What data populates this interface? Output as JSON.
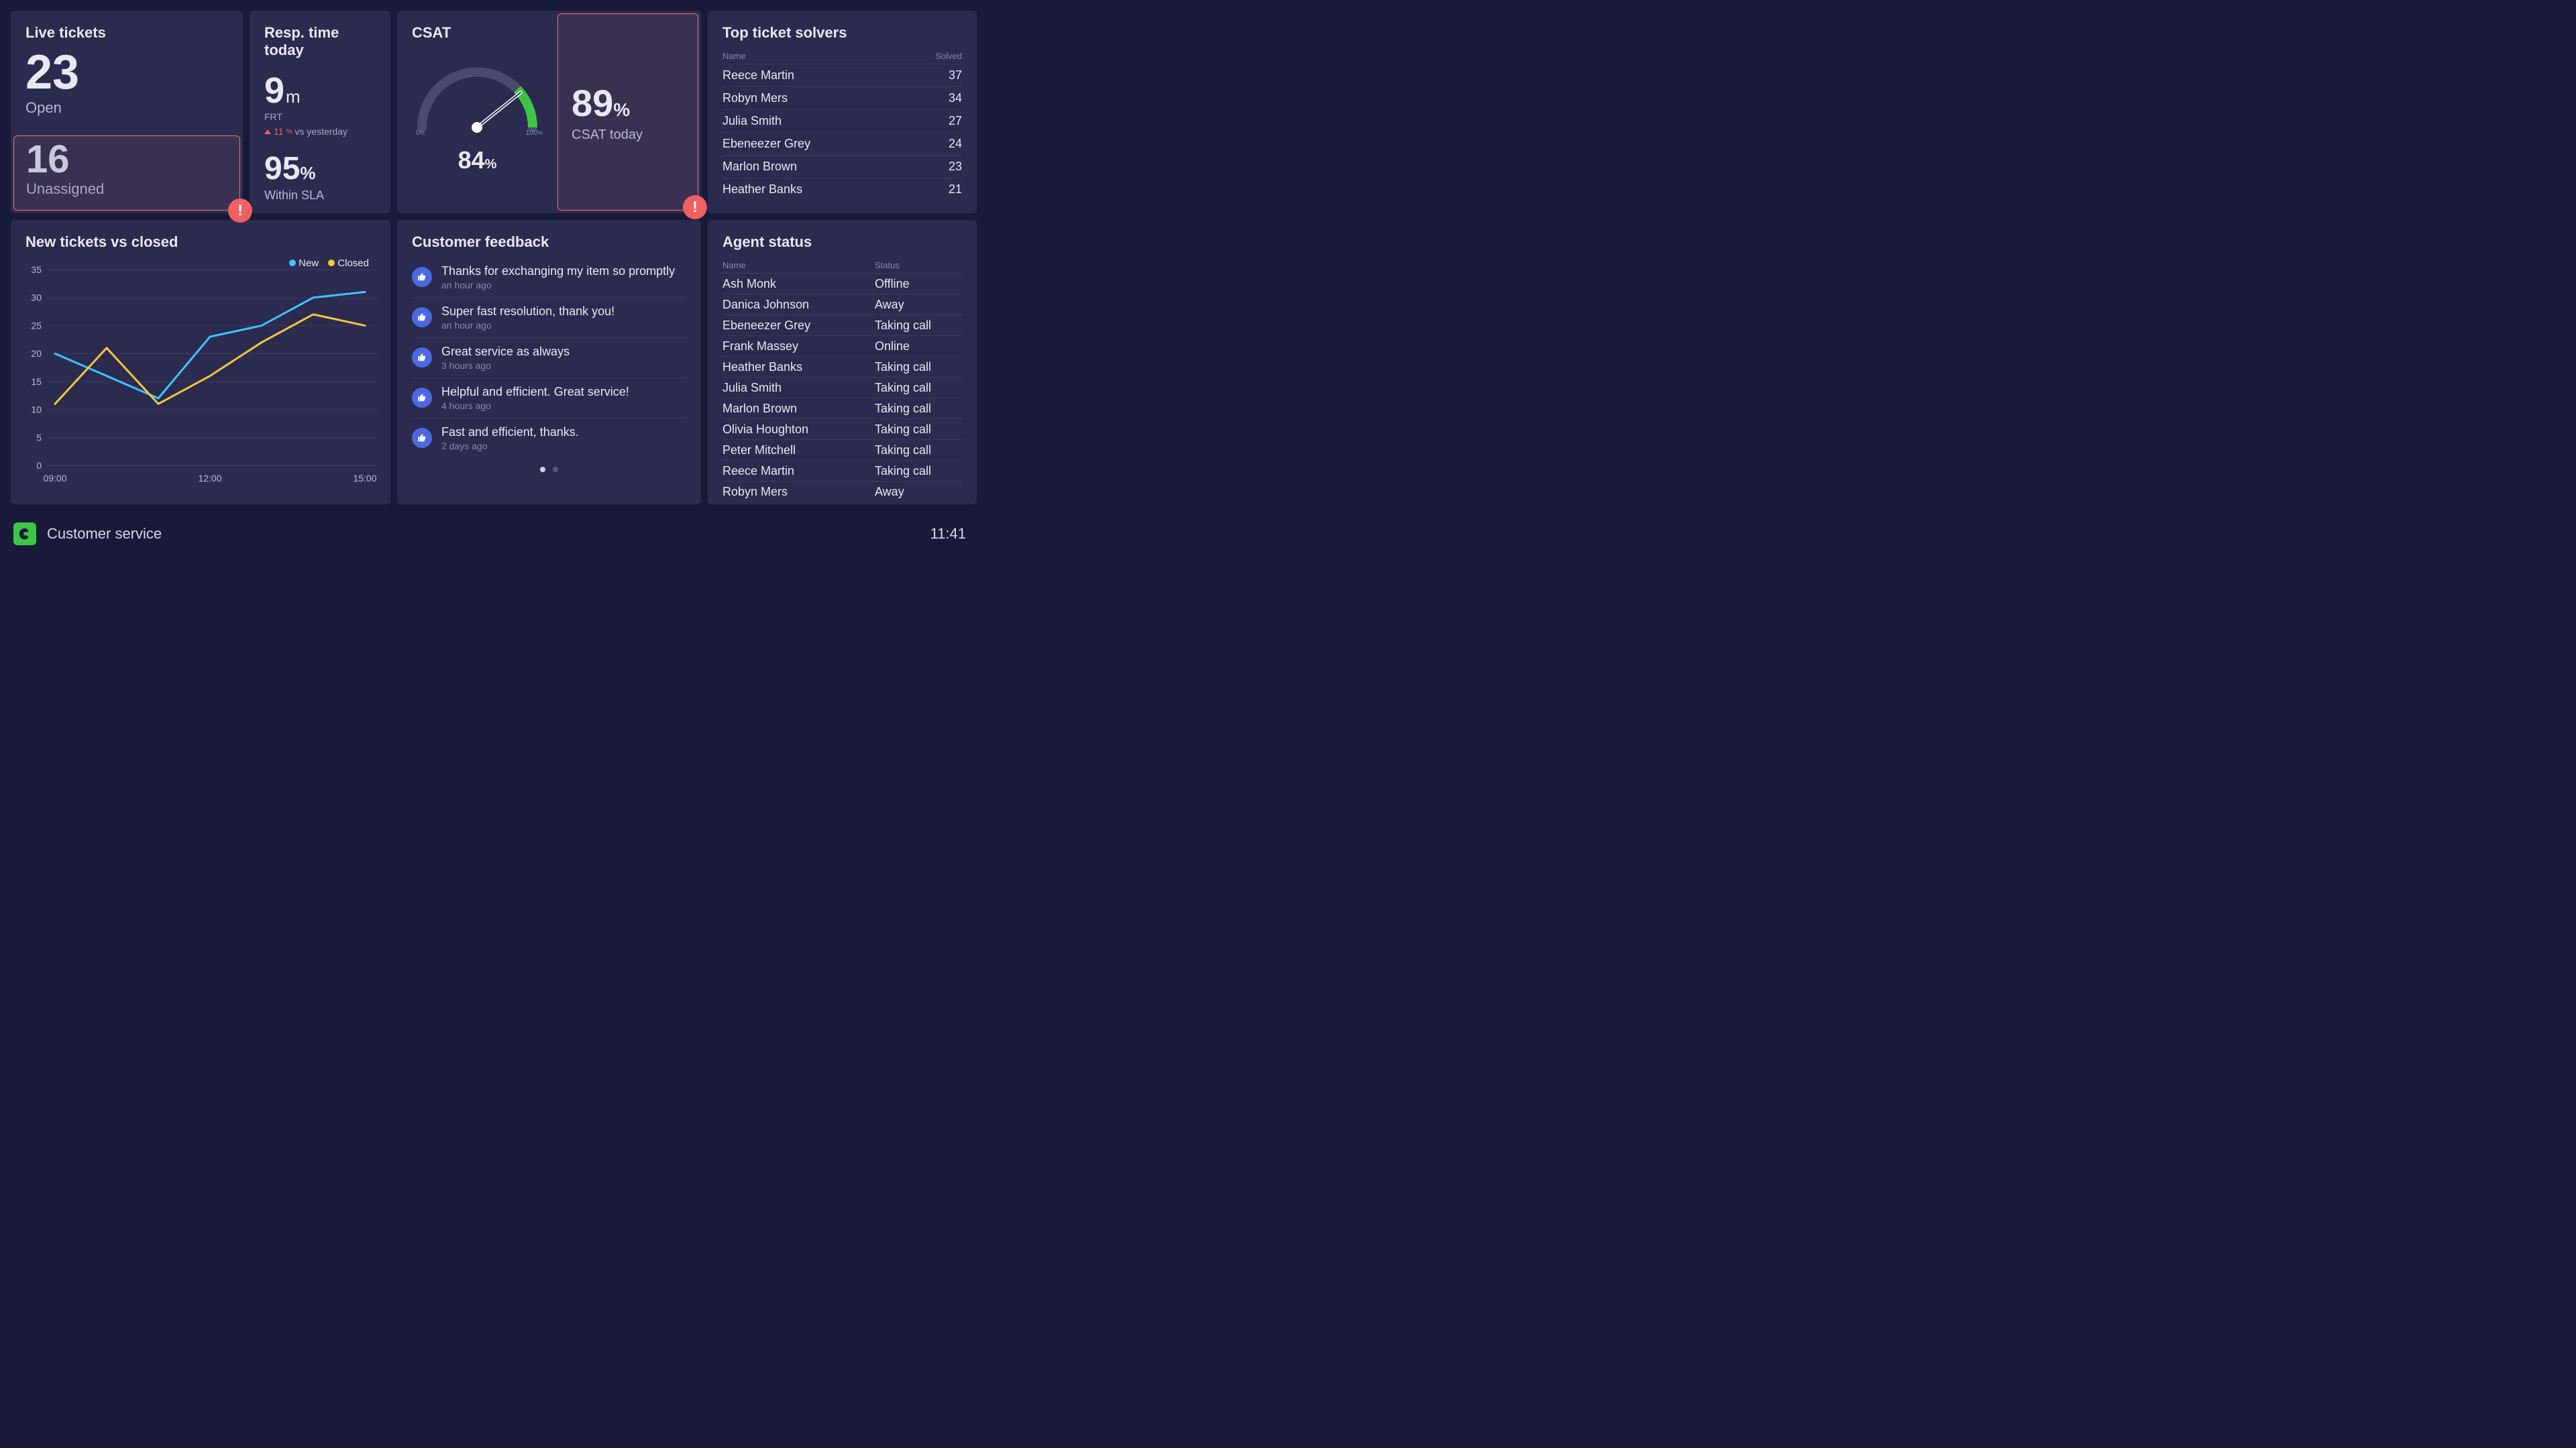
{
  "live_tickets": {
    "title": "Live tickets",
    "open_value": "23",
    "open_label": "Open",
    "unassigned_value": "16",
    "unassigned_label": "Unassigned"
  },
  "resp_time": {
    "title": "Resp. time today",
    "frt_value": "9",
    "frt_unit": "m",
    "frt_label": "FRT",
    "change_value": "11",
    "change_pct": "%",
    "change_vs": "vs yesterday",
    "sla_value": "95",
    "sla_pct": "%",
    "sla_label": "Within SLA"
  },
  "csat": {
    "title": "CSAT",
    "gauge_value": "84",
    "gauge_pct": "%",
    "scale_min": "0",
    "scale_min_pct": "%",
    "scale_max": "100",
    "scale_max_pct": "%",
    "today_value": "89",
    "today_pct": "%",
    "today_label": "CSAT today"
  },
  "top_solvers": {
    "title": "Top ticket solvers",
    "col_name": "Name",
    "col_solved": "Solved",
    "rows": [
      {
        "name": "Reece Martin",
        "solved": "37"
      },
      {
        "name": "Robyn Mers",
        "solved": "34"
      },
      {
        "name": "Julia Smith",
        "solved": "27"
      },
      {
        "name": "Ebeneezer Grey",
        "solved": "24"
      },
      {
        "name": "Marlon Brown",
        "solved": "23"
      },
      {
        "name": "Heather Banks",
        "solved": "21"
      }
    ]
  },
  "tickets_chart": {
    "title": "New tickets vs closed",
    "legend_new": "New",
    "legend_closed": "Closed"
  },
  "chart_data": {
    "type": "line",
    "categories": [
      "09:00",
      "10:00",
      "11:00",
      "12:00",
      "13:00",
      "14:00",
      "15:00"
    ],
    "x_ticks_shown": [
      "09:00",
      "12:00",
      "15:00"
    ],
    "series": [
      {
        "name": "New",
        "color": "#3fc4ff",
        "values": [
          20,
          16,
          12,
          23,
          25,
          30,
          31
        ]
      },
      {
        "name": "Closed",
        "color": "#f0c83c",
        "values": [
          11,
          21,
          11,
          16,
          22,
          27,
          25
        ]
      }
    ],
    "ylim": [
      0,
      35
    ],
    "y_ticks": [
      0,
      5,
      10,
      15,
      20,
      25,
      30,
      35
    ],
    "title": "New tickets vs closed",
    "xlabel": "",
    "ylabel": ""
  },
  "feedback": {
    "title": "Customer feedback",
    "items": [
      {
        "text": "Thanks for exchanging my item so promptly",
        "time": "an hour ago"
      },
      {
        "text": "Super fast resolution, thank you!",
        "time": "an hour ago"
      },
      {
        "text": "Great service as always",
        "time": "3 hours ago"
      },
      {
        "text": "Helpful and efficient. Great service!",
        "time": "4 hours ago"
      },
      {
        "text": "Fast and efficient, thanks.",
        "time": "2 days ago"
      }
    ]
  },
  "agent_status": {
    "title": "Agent status",
    "col_name": "Name",
    "col_status": "Status",
    "rows": [
      {
        "name": "Ash Monk",
        "status": "Offline"
      },
      {
        "name": "Danica Johnson",
        "status": "Away"
      },
      {
        "name": "Ebeneezer Grey",
        "status": "Taking call"
      },
      {
        "name": "Frank Massey",
        "status": "Online"
      },
      {
        "name": "Heather Banks",
        "status": "Taking call"
      },
      {
        "name": "Julia Smith",
        "status": "Taking call"
      },
      {
        "name": "Marlon Brown",
        "status": "Taking call"
      },
      {
        "name": "Olivia Houghton",
        "status": "Taking call"
      },
      {
        "name": "Peter Mitchell",
        "status": "Taking call"
      },
      {
        "name": "Reece Martin",
        "status": "Taking call"
      },
      {
        "name": "Robyn Mers",
        "status": "Away"
      }
    ]
  },
  "footer": {
    "title": "Customer service",
    "time": "11:41"
  },
  "alert": "!"
}
